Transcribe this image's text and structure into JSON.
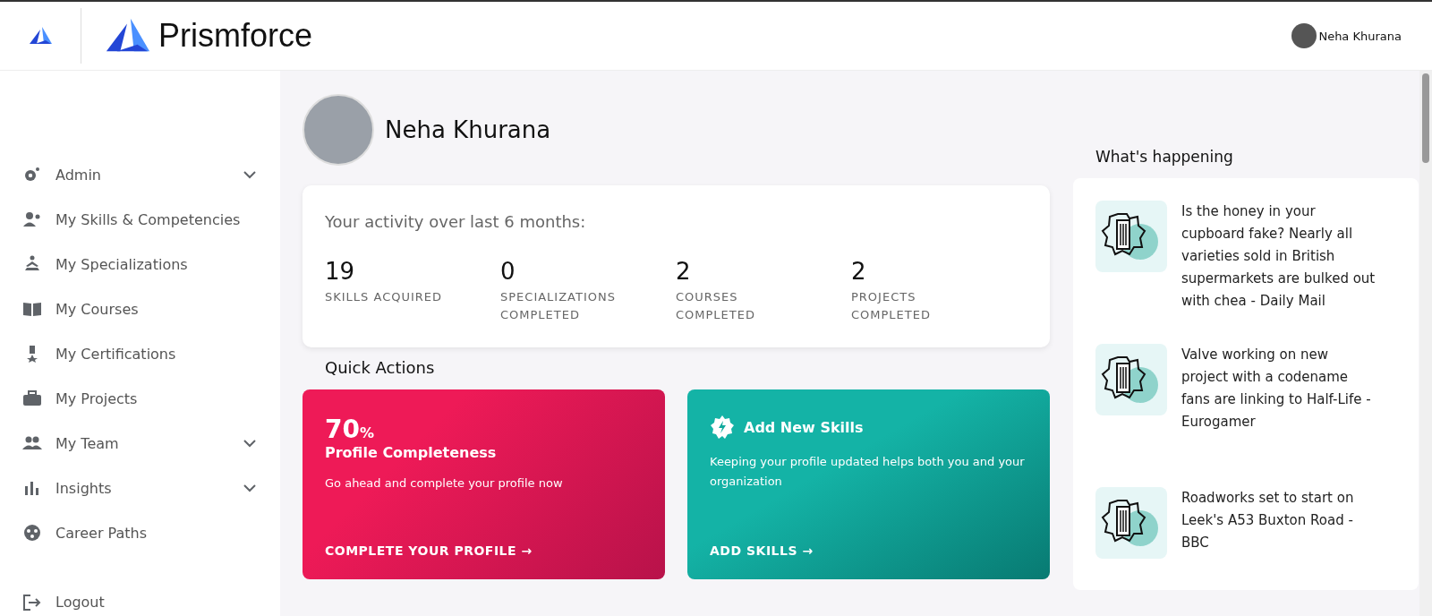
{
  "header": {
    "brand": "Prismforce",
    "user_name": "Neha Khurana"
  },
  "sidebar": {
    "items": [
      {
        "label": "Admin",
        "has_submenu": true
      },
      {
        "label": "My Skills & Competencies",
        "has_submenu": false
      },
      {
        "label": "My Specializations",
        "has_submenu": false
      },
      {
        "label": "My Courses",
        "has_submenu": false
      },
      {
        "label": "My Certifications",
        "has_submenu": false
      },
      {
        "label": "My Projects",
        "has_submenu": false
      },
      {
        "label": "My Team",
        "has_submenu": true
      },
      {
        "label": "Insights",
        "has_submenu": true
      },
      {
        "label": "Career Paths",
        "has_submenu": false
      }
    ],
    "logout": "Logout"
  },
  "profile": {
    "name": "Neha Khurana"
  },
  "activity": {
    "title": "Your activity over last 6 months:",
    "stats": [
      {
        "value": "19",
        "label": "SKILLS ACQUIRED"
      },
      {
        "value": "0",
        "label": "SPECIALIZATIONS COMPLETED"
      },
      {
        "value": "2",
        "label": "COURSES COMPLETED"
      },
      {
        "value": "2",
        "label": "PROJECTS COMPLETED"
      }
    ]
  },
  "quick_actions": {
    "title": "Quick Actions",
    "cards": [
      {
        "kind": "progress",
        "value": "70",
        "unit": "%",
        "title": "Profile Completeness",
        "text": "Go ahead and complete your profile now",
        "action": "COMPLETE YOUR PROFILE →"
      },
      {
        "kind": "skills",
        "title": "Add New Skills",
        "text": "Keeping your profile updated helps both you and your organization",
        "action": "ADD SKILLS →"
      }
    ]
  },
  "news": {
    "title": "What's happening",
    "items": [
      {
        "text": "Is the honey in your cupboard fake? Nearly all varieties sold in British supermarkets are bulked out with chea - Daily Mail"
      },
      {
        "text": "Valve working on new project with a codename fans are linking to Half-Life - Eurogamer"
      },
      {
        "text": "Roadworks set to start on Leek's A53 Buxton Road - BBC"
      }
    ]
  }
}
